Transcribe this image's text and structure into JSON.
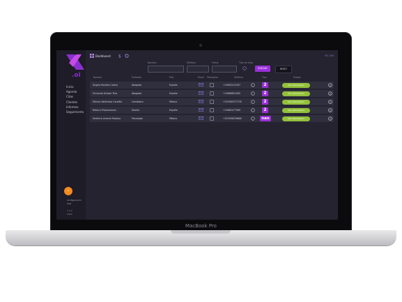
{
  "app": {
    "logo_text": ".oi",
    "title": "Dashboard",
    "top_right": "ES / EN",
    "brand": "MacBook Pro"
  },
  "sidebar": {
    "items": [
      "Inicio",
      "Agenda",
      "Citas",
      "Clientes",
      "Informes",
      "Seguimiento"
    ],
    "user_name": "Configuración",
    "user_role": "Salir",
    "footer_line1": "v 1.0",
    "footer_line2": "2024"
  },
  "filters": {
    "name_label": "Nombre",
    "phone_label": "Teléfono",
    "date_label": "Fecha",
    "type_label": "Tipo de citas",
    "search_label": "BUSCAR",
    "reset_label": "RESET"
  },
  "table": {
    "headers": [
      "Nombre",
      "Profesión",
      "País",
      "Email",
      "Mensajero",
      "Teléfono",
      "Tipo",
      "Estado"
    ],
    "rows": [
      {
        "name": "Ángela Morales Castro",
        "profession": "Abogada",
        "country": "España",
        "phone": "+34655222287",
        "badge": "2",
        "action": "Ver información"
      },
      {
        "name": "Fernanda Alcázar Ruiz",
        "profession": "Abogada",
        "country": "España",
        "phone": "+34688822465",
        "badge": "2",
        "action": "Ver información"
      },
      {
        "name": "Mónica Valdivieso Caudillo",
        "profession": "Contadora",
        "country": "México",
        "phone": "+525585577230",
        "badge": "2",
        "action": "Ver información"
      },
      {
        "name": "Rebeca Producciones",
        "profession": "Diseño",
        "country": "España",
        "phone": "+34662477569",
        "badge": "2",
        "action": "Ver información"
      },
      {
        "name": "Verónica Linares Palacios",
        "profession": "Psicología",
        "country": "México",
        "phone": "+525598228660",
        "badge": "nan",
        "action": "Ver información"
      }
    ]
  },
  "colors": {
    "accent": "#9a2fd8",
    "action": "#93c13a",
    "fab": "#f38a1f",
    "screen_bg": "#24232f",
    "sidebar_bg": "#1d1c27",
    "row_bg": "#302f3d"
  },
  "icons": {
    "email": "envelope-icon",
    "messenger": "message-square-icon",
    "whatsapp": "whatsapp-icon",
    "info": "info-circle-icon"
  }
}
